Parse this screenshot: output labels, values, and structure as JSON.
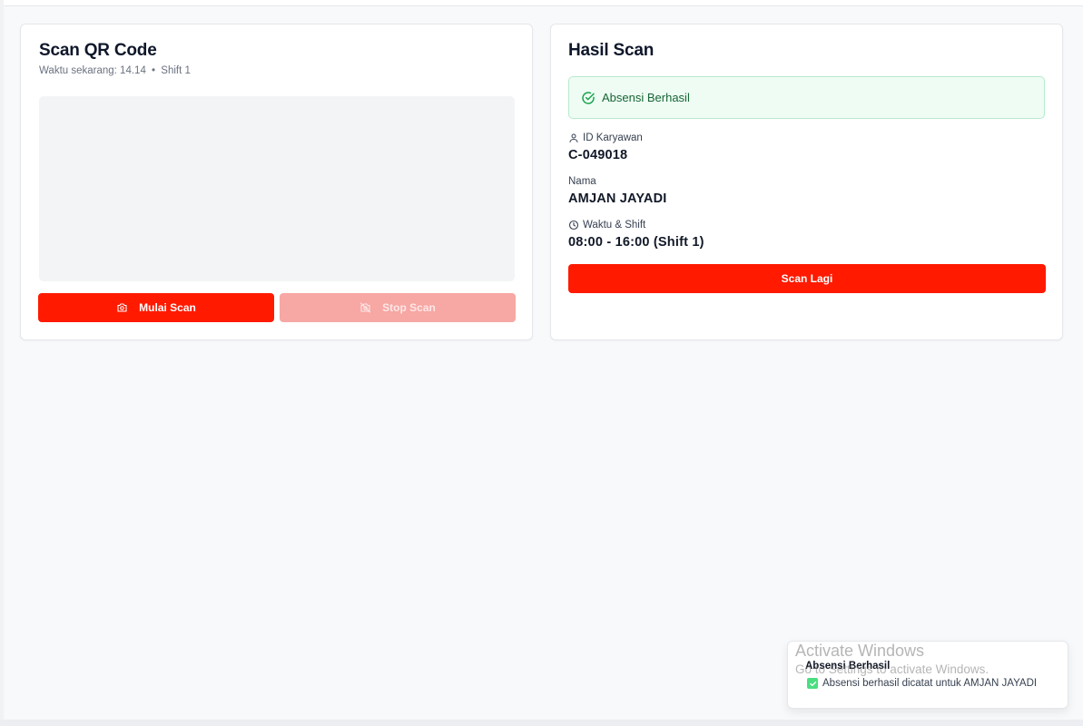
{
  "scanner": {
    "title": "Scan QR Code",
    "time_label": "Waktu sekarang: 14.14",
    "separator": "•",
    "shift": "Shift 1",
    "start_button": "Mulai Scan",
    "stop_button": "Stop Scan"
  },
  "result": {
    "title": "Hasil Scan",
    "status": "Absensi Berhasil",
    "employee_id_label": "ID Karyawan",
    "employee_id": "C-049018",
    "name_label": "Nama",
    "name": "AMJAN JAYADI",
    "time_shift_label": "Waktu & Shift",
    "time_shift": "08:00 - 16:00 (Shift 1)",
    "scan_again_button": "Scan Lagi"
  },
  "toast": {
    "title": "Absensi Berhasil",
    "message": "Absensi berhasil dicatat untuk AMJAN JAYADI"
  },
  "watermark": {
    "line1": "Activate Windows",
    "line2": "Go to Settings to activate Windows."
  },
  "colors": {
    "primary": "#ff1a00",
    "primary_disabled": "#f7a7a4",
    "success_bg": "#effcf4",
    "success_text": "#166534"
  },
  "icons": {
    "start": "camera-icon",
    "stop": "camera-off-icon",
    "status": "check-circle-icon",
    "employee": "user-icon",
    "time": "clock-icon",
    "toast": "check-square-icon"
  }
}
